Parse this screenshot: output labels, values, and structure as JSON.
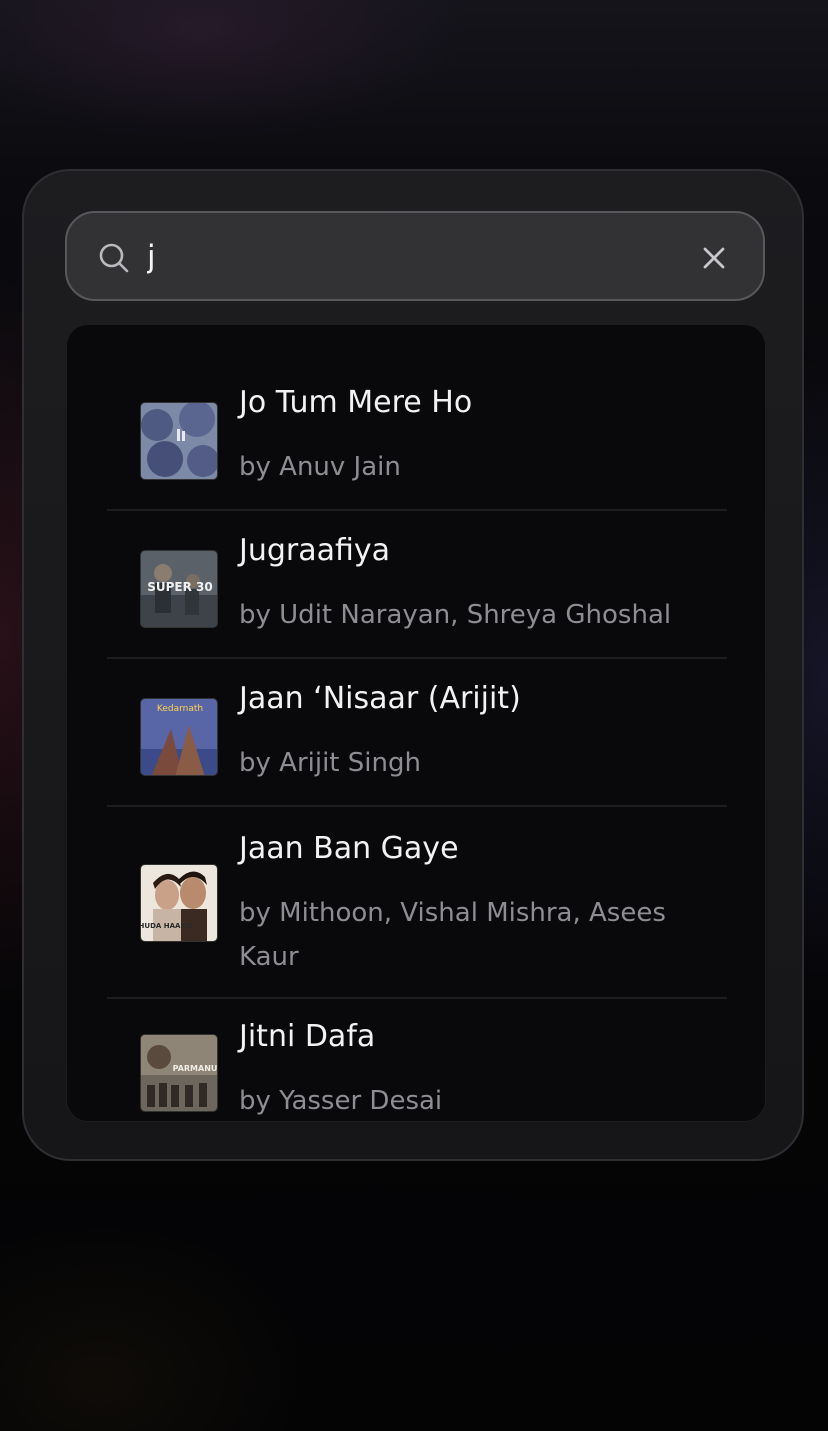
{
  "search": {
    "value": "j",
    "placeholder": ""
  },
  "results": [
    {
      "title": "Jo Tum Mere Ho",
      "artist": "by Anuv Jain",
      "art": "jo-tum-mere-ho-cover"
    },
    {
      "title": "Jugraafiya",
      "artist": "by Udit Narayan, Shreya Ghoshal",
      "art": "super-30-cover",
      "art_text": "SUPER 30"
    },
    {
      "title": "Jaan ‘Nisaar (Arijit)",
      "artist": "by Arijit Singh",
      "art": "kedarnath-cover",
      "art_text": "Kedarnath"
    },
    {
      "title": "Jaan Ban Gaye",
      "artist": "by Mithoon, Vishal Mishra, Asees Kaur",
      "art": "khuda-haafiz-cover",
      "art_text": "KHUDA HAAFIZ"
    },
    {
      "title": "Jitni Dafa",
      "artist": "by Yasser Desai",
      "art": "parmanu-cover",
      "art_text": "PARMANU"
    }
  ],
  "icons": {
    "search": "search-icon",
    "clear": "close-icon"
  },
  "colors": {
    "panel": "#1b1b1e",
    "search_field": "#323235",
    "results_bg": "#09090b",
    "title_text": "#f2f2f4",
    "artist_text": "#8d8d93"
  }
}
